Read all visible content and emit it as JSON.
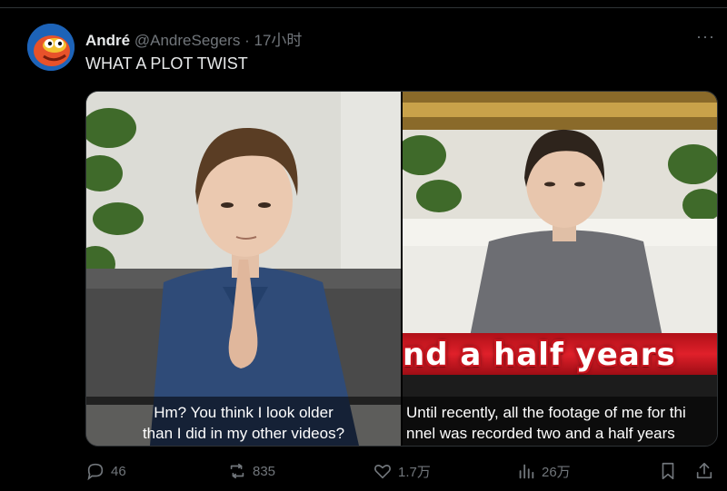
{
  "tweet": {
    "author_name": "André",
    "handle": "@AndreSegers",
    "separator": "·",
    "time": "17小时",
    "more_label": "···",
    "text": "WHAT A PLOT TWIST"
  },
  "media": {
    "left_subtitle_line1": "Hm? You think I look older",
    "left_subtitle_line2": "than I did in my other videos?",
    "right_overlay": "nd a half years",
    "right_subtitle_line1": "Until recently, all the footage of me for thi",
    "right_subtitle_line2": "nnel was recorded two and a half years"
  },
  "actions": {
    "replies": "46",
    "reposts": "835",
    "likes": "1.7万",
    "views": "26万"
  },
  "icons": [
    "reply-icon",
    "repost-icon",
    "like-icon",
    "views-icon",
    "bookmark-icon",
    "share-icon"
  ],
  "colors": {
    "background": "#000000",
    "text": "#e7e9ea",
    "muted": "#71767b",
    "overlay_red": "#c8141e"
  }
}
